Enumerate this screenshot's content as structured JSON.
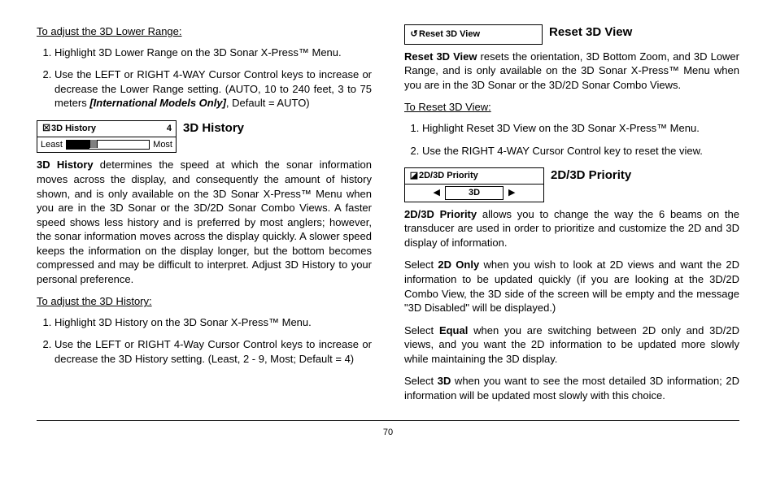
{
  "left": {
    "adjust_lower_title": "To adjust the 3D Lower Range:",
    "adjust_lower_steps": [
      "Highlight 3D Lower Range on the 3D Sonar X-Press™ Menu.",
      "Use the LEFT or RIGHT 4-WAY Cursor Control keys to increase or decrease the Lower Range setting. (AUTO, 10 to 240 feet, 3 to 75 meters "
    ],
    "adjust_lower_step2_italic": "[International Models Only]",
    "adjust_lower_step2_tail": ", Default = AUTO)",
    "history_widget": {
      "icon": "☒",
      "title": "3D History",
      "value": "4",
      "left_label": "Least",
      "right_label": "Most"
    },
    "history_heading": "3D History",
    "history_lead_bold": "3D History",
    "history_lead_rest": " determines the speed at which the sonar information moves across the display, and consequently the amount of history shown, and is only available on the 3D Sonar X-Press™ Menu when you are in the 3D Sonar or the 3D/2D Sonar Combo Views. A faster speed shows less history and is preferred by most anglers; however, the sonar information moves across the display quickly. A slower speed keeps the information on the display longer, but the bottom becomes compressed and may be difficult to  interpret. Adjust 3D History to your personal preference.",
    "adjust_history_title": "To adjust the 3D History:",
    "adjust_history_steps": [
      "Highlight 3D History on the 3D Sonar X-Press™ Menu.",
      "Use the LEFT or RIGHT 4-Way Cursor Control keys to increase or decrease the 3D History setting. (Least, 2 - 9, Most; Default = 4)"
    ]
  },
  "right": {
    "reset_widget": {
      "icon": "↺",
      "title": "Reset 3D View"
    },
    "reset_heading": "Reset 3D View",
    "reset_lead_bold": "Reset 3D View",
    "reset_lead_rest": " resets the orientation, 3D Bottom Zoom, and 3D Lower Range, and is only available on the 3D Sonar X-Press™ Menu when you are in the 3D Sonar or the 3D/2D Sonar Combo Views.",
    "reset_steps_title": "To Reset 3D View:",
    "reset_steps": [
      "Highlight Reset 3D View on the 3D Sonar X-Press™ Menu.",
      "Use the RIGHT 4-WAY Cursor Control key to reset the view."
    ],
    "priority_widget": {
      "icon": "◪",
      "title": "2D/3D Priority",
      "value": "3D",
      "left_arrow": "◀",
      "right_arrow": "▶"
    },
    "priority_heading": "2D/3D Priority",
    "priority_lead_bold": "2D/3D Priority",
    "priority_lead_rest": " allows you to change the way the 6 beams on the transducer are used in order to prioritize and customize the 2D and 3D display of information.",
    "p2_lead": "Select ",
    "p2_bold": "2D Only",
    "p2_rest": " when you wish to look at 2D views and want the 2D information to be updated quickly (if you are looking at the 3D/2D Combo View, the 3D side of the screen will be empty and the message \"3D Disabled\" will be displayed.)",
    "p3_lead": "Select ",
    "p3_bold": "Equal",
    "p3_rest": " when you are switching between 2D only and 3D/2D views, and you want the 2D information to be updated more slowly while maintaining the 3D display.",
    "p4_lead": "Select ",
    "p4_bold": "3D",
    "p4_rest": " when you want to see the most detailed 3D information; 2D information will be updated most slowly with this choice."
  },
  "page_number": "70"
}
